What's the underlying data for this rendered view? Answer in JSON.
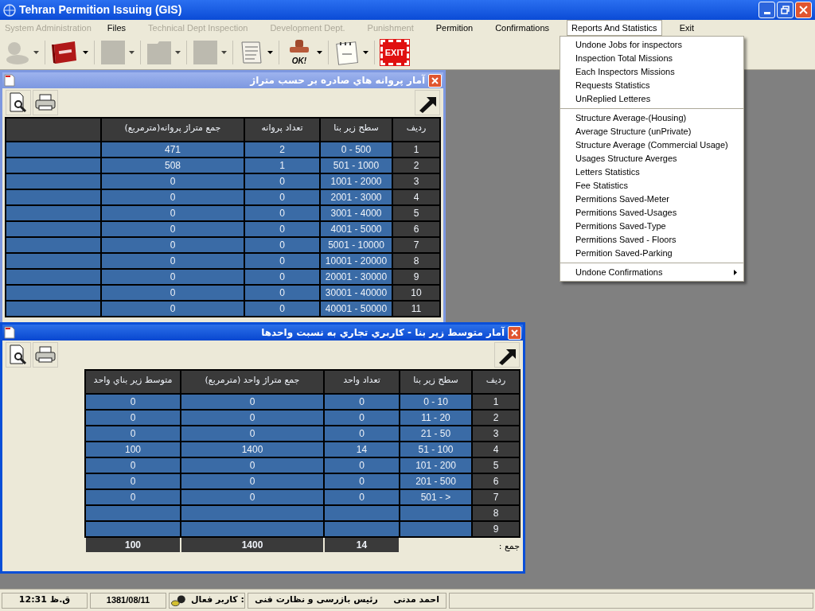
{
  "window": {
    "title": "Tehran Permition Issuing (GIS)"
  },
  "menu": [
    {
      "label": "System Administration",
      "disabled": true,
      "selected": false
    },
    {
      "label": "Files",
      "disabled": false,
      "selected": false
    },
    {
      "label": "Technical Dept  Inspection",
      "disabled": true,
      "selected": false
    },
    {
      "label": "Development Dept.",
      "disabled": true,
      "selected": false
    },
    {
      "label": "Punishment",
      "disabled": true,
      "selected": false
    },
    {
      "label": "Permition",
      "disabled": false,
      "selected": false
    },
    {
      "label": "Confirmations",
      "disabled": false,
      "selected": false
    },
    {
      "label": "Reports And Statistics",
      "disabled": false,
      "selected": true
    },
    {
      "label": "Exit",
      "disabled": false,
      "selected": false
    }
  ],
  "open_menu": {
    "groups": [
      {
        "items": [
          {
            "label": "Undone Jobs for inspectors",
            "submenu": false
          },
          {
            "label": "Inspection Total Missions",
            "submenu": false
          },
          {
            "label": "Each Inspectors Missions",
            "submenu": false
          },
          {
            "label": "Requests Statistics",
            "submenu": false
          },
          {
            "label": "UnReplied Letteres",
            "submenu": false
          }
        ]
      },
      {
        "items": [
          {
            "label": "Structure Average-(Housing)",
            "submenu": false
          },
          {
            "label": "Average Structure (unPrivate)",
            "submenu": false
          },
          {
            "label": "Structure Average (Commercial Usage)",
            "submenu": false
          },
          {
            "label": "Usages Structure Averges",
            "submenu": false
          },
          {
            "label": "Letters Statistics",
            "submenu": false
          },
          {
            "label": "Fee Statistics",
            "submenu": false
          },
          {
            "label": "Permitions Saved-Meter",
            "submenu": false
          },
          {
            "label": "Permitions Saved-Usages",
            "submenu": false
          },
          {
            "label": "Permitions Saved-Type",
            "submenu": false
          },
          {
            "label": "Permitions Saved - Floors",
            "submenu": false
          },
          {
            "label": "Permition Saved-Parking",
            "submenu": false
          }
        ]
      },
      {
        "items": [
          {
            "label": "Undone Confirmations",
            "submenu": true
          }
        ]
      }
    ]
  },
  "toolbar": [
    {
      "kind": "person",
      "disabled": true
    },
    {
      "kind": "book",
      "disabled": false
    },
    {
      "kind": "blank",
      "disabled": true
    },
    {
      "kind": "folder",
      "disabled": true
    },
    {
      "kind": "blank",
      "disabled": true
    },
    {
      "kind": "document",
      "disabled": false
    },
    {
      "kind": "stamp",
      "disabled": false,
      "label": "OK!"
    },
    {
      "kind": "notepad",
      "disabled": false
    },
    {
      "kind": "exit",
      "disabled": false,
      "label": "EXIT"
    }
  ],
  "report_windows": [
    {
      "title": "آمار پروانه هاي صادره بر حسب متراژ",
      "active": false,
      "leading_blank_column": true,
      "columns": [
        "جمع متراژ پروانه(مترمربع)",
        "تعداد پروانه",
        "سطح زير بنا",
        "رديف"
      ],
      "rows": [
        [
          "471",
          "2",
          "0 - 500",
          "1"
        ],
        [
          "508",
          "1",
          "501 - 1000",
          "2"
        ],
        [
          "0",
          "0",
          "1001 - 2000",
          "3"
        ],
        [
          "0",
          "0",
          "2001 - 3000",
          "4"
        ],
        [
          "0",
          "0",
          "3001 - 4000",
          "5"
        ],
        [
          "0",
          "0",
          "4001 - 5000",
          "6"
        ],
        [
          "0",
          "0",
          "5001 - 10000",
          "7"
        ],
        [
          "0",
          "0",
          "10001 - 20000",
          "8"
        ],
        [
          "0",
          "0",
          "20001 - 30000",
          "9"
        ],
        [
          "0",
          "0",
          "30001 - 40000",
          "10"
        ],
        [
          "0",
          "0",
          "40001 - 50000",
          "11"
        ]
      ]
    },
    {
      "title": "آمار متوسط زير بنا - کاربري تجاري به نسبت واحدها",
      "active": true,
      "leading_blank_column": false,
      "columns": [
        "متوسط زير بناي واحد",
        "جمع متراژ واحد (مترمربع)",
        "تعداد واحد",
        "سطح زير بنا",
        "رديف"
      ],
      "rows": [
        [
          "0",
          "0",
          "0",
          "0 - 10",
          "1"
        ],
        [
          "0",
          "0",
          "0",
          "11 - 20",
          "2"
        ],
        [
          "0",
          "0",
          "0",
          "21 - 50",
          "3"
        ],
        [
          "100",
          "1400",
          "14",
          "51 - 100",
          "4"
        ],
        [
          "0",
          "0",
          "0",
          "101 - 200",
          "5"
        ],
        [
          "0",
          "0",
          "0",
          "201 - 500",
          "6"
        ],
        [
          "0",
          "0",
          "0",
          "501 -  >",
          "7"
        ],
        [
          "8"
        ],
        [
          "9"
        ]
      ],
      "totals": {
        "values": [
          "100",
          "1400",
          "14"
        ],
        "label": "جمع :"
      }
    }
  ],
  "status_bar": {
    "time": "12:31 ق.ظ",
    "date": "1381/08/11",
    "user_label": ": کاربر فعال",
    "role": "رئيس بازرسی و نظارت فنی",
    "user_name": "احمد مدنی"
  }
}
